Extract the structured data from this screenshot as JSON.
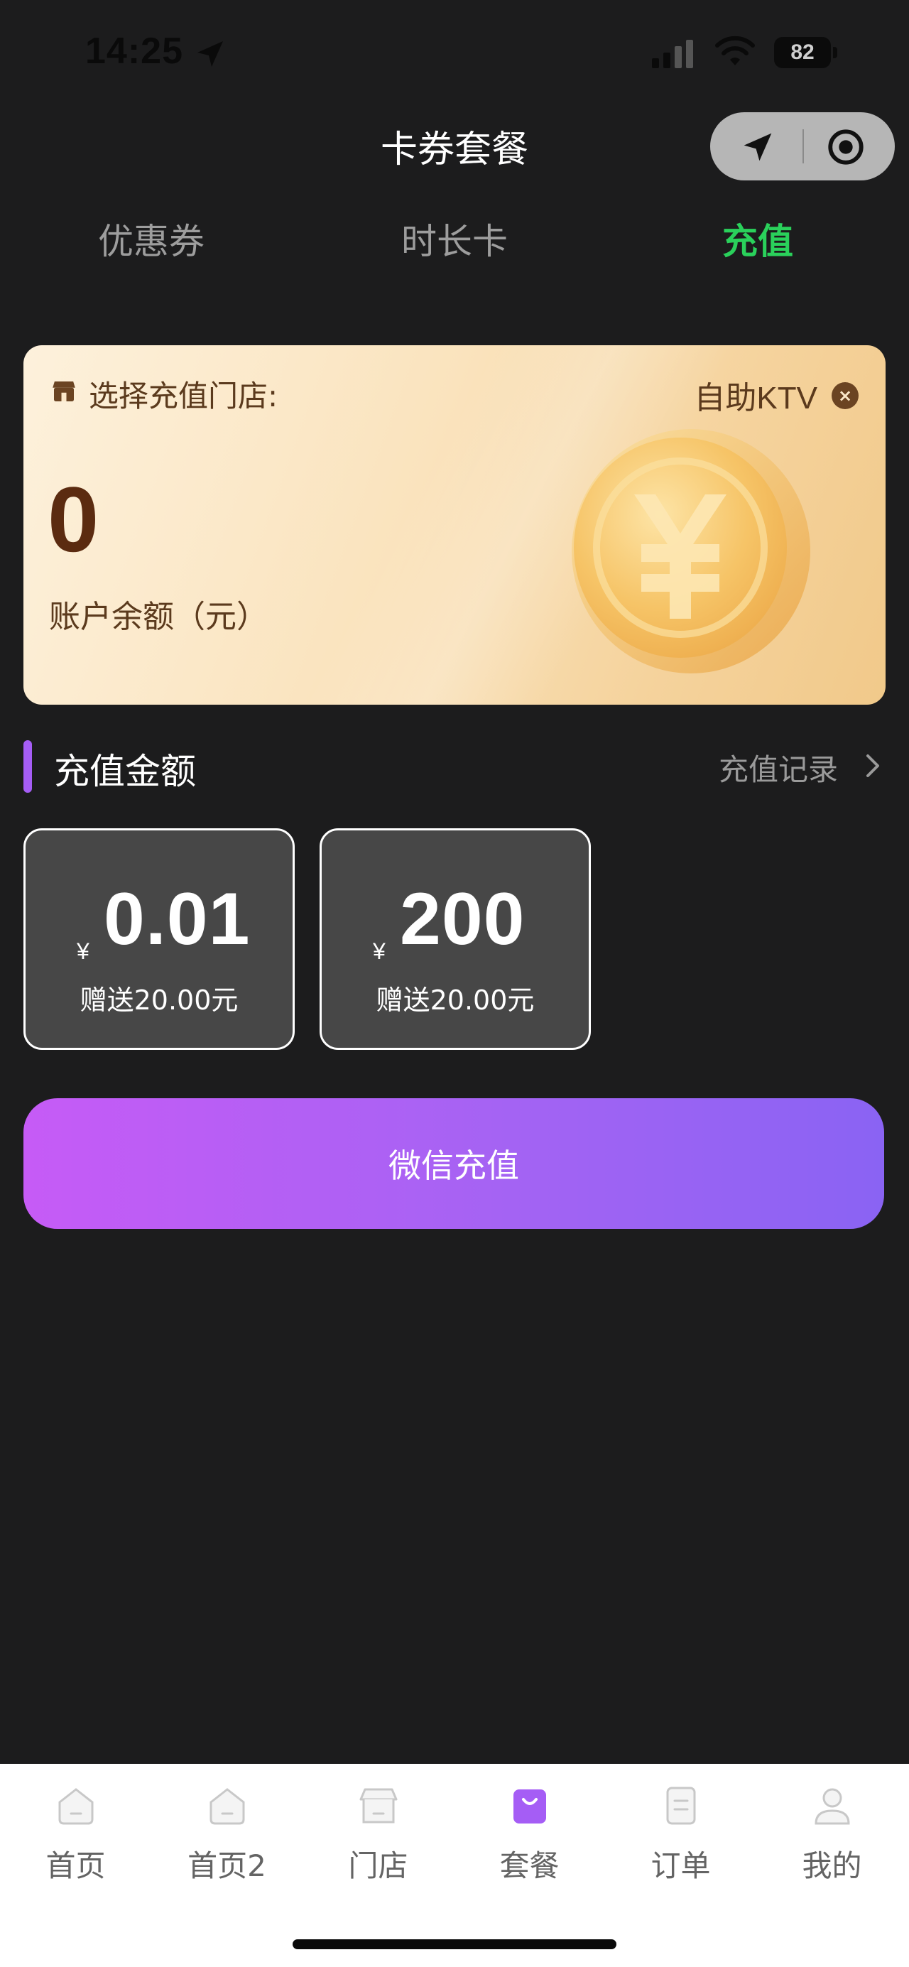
{
  "status_bar": {
    "time": "14:25",
    "battery": "82"
  },
  "header": {
    "title": "卡券套餐",
    "capsule_icons": [
      "navigation-arrow-icon",
      "target-circle-icon"
    ]
  },
  "tabs": [
    {
      "label": "优惠券",
      "active": false
    },
    {
      "label": "时长卡",
      "active": false
    },
    {
      "label": "充值",
      "active": true
    }
  ],
  "balance_card": {
    "store_label": "选择充值门店:",
    "store_name": "自助KTV",
    "clear_icon": "×",
    "balance": "0",
    "balance_label": "账户余额（元）"
  },
  "section": {
    "title": "充值金额",
    "history_link": "充值记录"
  },
  "amount_options": [
    {
      "currency": "¥",
      "amount": "0.01",
      "bonus": "赠送20.00元"
    },
    {
      "currency": "¥",
      "amount": "200",
      "bonus": "赠送20.00元"
    }
  ],
  "pay_button": {
    "label": "微信充值"
  },
  "tabbar": [
    {
      "label": "首页",
      "icon": "home-icon",
      "active": false
    },
    {
      "label": "首页2",
      "icon": "home-icon",
      "active": false
    },
    {
      "label": "门店",
      "icon": "store-icon",
      "active": false
    },
    {
      "label": "套餐",
      "icon": "shopping-bag-icon",
      "active": true
    },
    {
      "label": "订单",
      "icon": "order-document-icon",
      "active": false
    },
    {
      "label": "我的",
      "icon": "user-icon",
      "active": false
    }
  ],
  "colors": {
    "background": "#1c1c1d",
    "active_tab": "#2ad15b",
    "accent_purple": "#a55df5",
    "pay_gradient_start": "#c65bf6",
    "pay_gradient_end": "#8a63f3",
    "card_gold": "#f5d39d"
  }
}
